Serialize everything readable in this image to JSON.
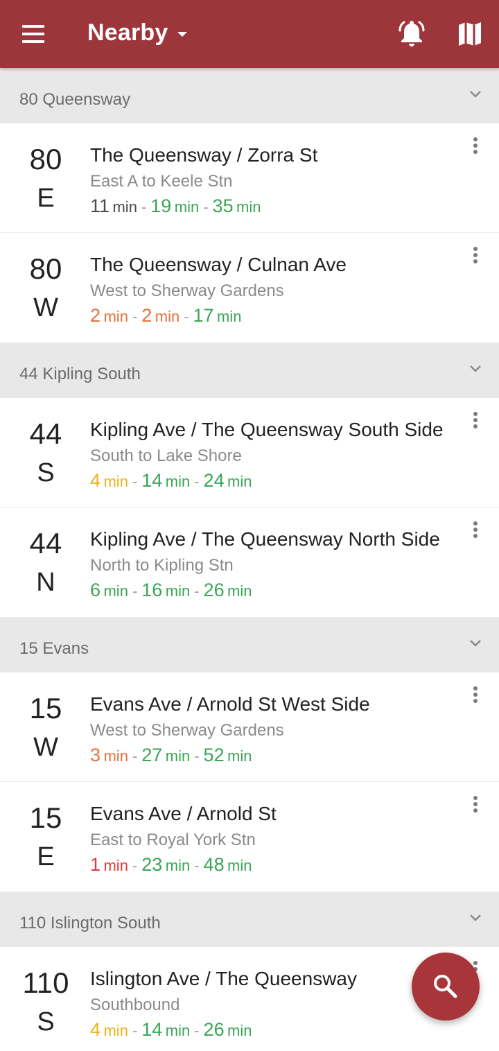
{
  "app_bar": {
    "title": "Nearby",
    "icons": {
      "menu": "menu-icon",
      "dropdown": "dropdown-caret-icon",
      "alerts": "bell-alert-icon",
      "map": "map-icon"
    }
  },
  "colors": {
    "app_bar": "#9c363a",
    "fab": "#a8353a",
    "section_bg": "#e8e8e8",
    "time_gray": "#4a4a4a",
    "time_green": "#3aa655",
    "time_orange": "#e8703a",
    "time_yellow": "#efb21a",
    "time_red": "#e53935"
  },
  "sections": [
    {
      "title": "80 Queensway",
      "stops": [
        {
          "route": "80",
          "dir": "E",
          "name": "The Queensway / Zorra St",
          "dest": "East A to Keele Stn",
          "times": [
            {
              "v": "11",
              "u": "min",
              "c": "gray"
            },
            {
              "v": "19",
              "u": "min",
              "c": "green"
            },
            {
              "v": "35",
              "u": "min",
              "c": "green"
            }
          ]
        },
        {
          "route": "80",
          "dir": "W",
          "name": "The Queensway / Culnan Ave",
          "dest": "West to Sherway Gardens",
          "times": [
            {
              "v": "2",
              "u": "min",
              "c": "orange"
            },
            {
              "v": "2",
              "u": "min",
              "c": "orange"
            },
            {
              "v": "17",
              "u": "min",
              "c": "green"
            }
          ]
        }
      ]
    },
    {
      "title": "44 Kipling South",
      "stops": [
        {
          "route": "44",
          "dir": "S",
          "name": "Kipling Ave / The Queensway South Side",
          "dest": "South to Lake Shore",
          "times": [
            {
              "v": "4",
              "u": "min",
              "c": "yellow"
            },
            {
              "v": "14",
              "u": "min",
              "c": "green"
            },
            {
              "v": "24",
              "u": "min",
              "c": "green"
            }
          ]
        },
        {
          "route": "44",
          "dir": "N",
          "name": "Kipling Ave / The Queensway North Side",
          "dest": "North to Kipling Stn",
          "times": [
            {
              "v": "6",
              "u": "min",
              "c": "green"
            },
            {
              "v": "16",
              "u": "min",
              "c": "green"
            },
            {
              "v": "26",
              "u": "min",
              "c": "green"
            }
          ]
        }
      ]
    },
    {
      "title": "15 Evans",
      "stops": [
        {
          "route": "15",
          "dir": "W",
          "name": "Evans Ave / Arnold St West Side",
          "dest": "West to Sherway Gardens",
          "times": [
            {
              "v": "3",
              "u": "min",
              "c": "orange"
            },
            {
              "v": "27",
              "u": "min",
              "c": "green"
            },
            {
              "v": "52",
              "u": "min",
              "c": "green"
            }
          ]
        },
        {
          "route": "15",
          "dir": "E",
          "name": "Evans Ave / Arnold St",
          "dest": "East to Royal York Stn",
          "times": [
            {
              "v": "1",
              "u": "min",
              "c": "red"
            },
            {
              "v": "23",
              "u": "min",
              "c": "green"
            },
            {
              "v": "48",
              "u": "min",
              "c": "green"
            }
          ]
        }
      ]
    },
    {
      "title": "110 Islington South",
      "stops": [
        {
          "route": "110",
          "dir": "S",
          "name": "Islington Ave / The Queensway",
          "dest": "Southbound",
          "times": [
            {
              "v": "4",
              "u": "min",
              "c": "yellow"
            },
            {
              "v": "14",
              "u": "min",
              "c": "green"
            },
            {
              "v": "26",
              "u": "min",
              "c": "green"
            }
          ]
        }
      ]
    }
  ],
  "fab": {
    "icon": "search-icon"
  },
  "separator": "-"
}
